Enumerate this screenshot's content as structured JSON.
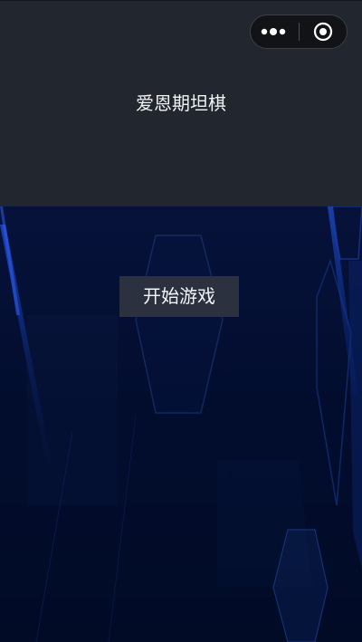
{
  "navbar": {
    "title": "爱恩期坦棋",
    "capsule": {
      "more_icon": "more-dots-icon",
      "close_icon": "target-circle-icon"
    }
  },
  "game": {
    "start_button_label": "开始游戏",
    "background_icon": "hexagon-tech-background"
  },
  "colors": {
    "header_bg": "#22262f",
    "game_bg": "#020d2e",
    "button_bg": "#2c3140",
    "accent_blue": "#1f4fd6"
  }
}
